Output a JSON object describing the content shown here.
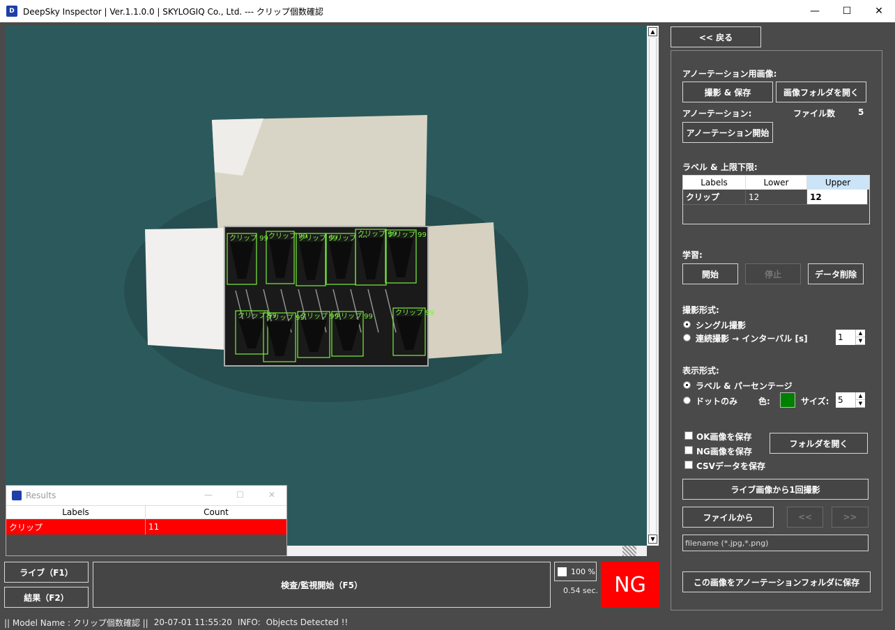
{
  "window": {
    "title": "DeepSky Inspector | Ver.1.1.0.0 | SKYLOGIQ Co., Ltd. --- クリップ個数確認",
    "min_icon": "minimize-icon",
    "max_icon": "maximize-icon",
    "close_icon": "close-icon"
  },
  "viewer": {
    "detections": [
      {
        "label": "クリップ",
        "score": "99"
      },
      {
        "label": "クリップ",
        "score": "99"
      },
      {
        "label": "クリップ",
        "score": "99"
      },
      {
        "label": "クリップ",
        "score": "99"
      },
      {
        "label": "クリップ",
        "score": "99"
      },
      {
        "label": "クリップ",
        "score": "99"
      },
      {
        "label": "クリップ",
        "score": "99"
      },
      {
        "label": "クリップ",
        "score": "99"
      },
      {
        "label": "クリップ",
        "score": "99"
      },
      {
        "label": "クリップ",
        "score": "99"
      },
      {
        "label": "クリップ",
        "score": "99"
      }
    ],
    "box_color": "#7cf03c"
  },
  "results": {
    "title": "Results",
    "columns": [
      "Labels",
      "Count"
    ],
    "rows": [
      {
        "label": "クリップ",
        "count": "11"
      }
    ],
    "row_color": "#ff0000"
  },
  "controls": {
    "live_button": "ライブ（F1）",
    "result_button": "結果（F2）",
    "inspect_button": "検査/監視開始（F5）",
    "zoom": "100 %",
    "elapsed": "0.54 sec.",
    "judgement": "NG",
    "judgement_color": "#ff0000"
  },
  "status": {
    "model": "|| Model Name : クリップ個数確認 ||",
    "timestamp": "20-07-01 11:55:20",
    "info_label": "INFO:",
    "info_text": "Objects Detected !!"
  },
  "panel": {
    "back_button": "<< 戻る",
    "annotation_image_label": "アノーテーション用画像:",
    "capture_save_button": "撮影 & 保存",
    "open_image_folder_button": "画像フォルダを開く",
    "annotation_label": "アノーテーション:",
    "file_count_label": "ファイル数",
    "file_count": "5",
    "annotation_start_button": "アノーテーション開始",
    "labels_limits_label": "ラベル & 上限下限:",
    "table": {
      "columns": [
        "Labels",
        "Lower",
        "Upper"
      ],
      "rows": [
        {
          "label": "クリップ",
          "lower": "12",
          "upper": "12"
        }
      ]
    },
    "learning_label": "学習:",
    "start_button": "開始",
    "stop_button": "停止",
    "delete_data_button": "データ削除",
    "capture_mode_label": "撮影形式:",
    "single_capture": "シングル撮影",
    "continuous_capture": "連続撮影 → インターバル [s]",
    "interval_value": "1",
    "display_mode_label": "表示形式:",
    "label_percentage": "ラベル & パーセンテージ",
    "dot_only": "ドットのみ",
    "color_label": "色:",
    "dot_color": "#008000",
    "size_label": "サイズ:",
    "size_value": "5",
    "save_ok": "OK画像を保存",
    "save_ng": "NG画像を保存",
    "save_csv": "CSVデータを保存",
    "open_folder_button": "フォルダを開く",
    "capture_once_button": "ライブ画像から1回撮影",
    "from_file_button": "ファイルから",
    "prev_button": "<<",
    "next_button": ">>",
    "filename_value": "filename (*.jpg,*.png)",
    "save_to_annotation_button": "この画像をアノーテーションフォルダに保存"
  }
}
